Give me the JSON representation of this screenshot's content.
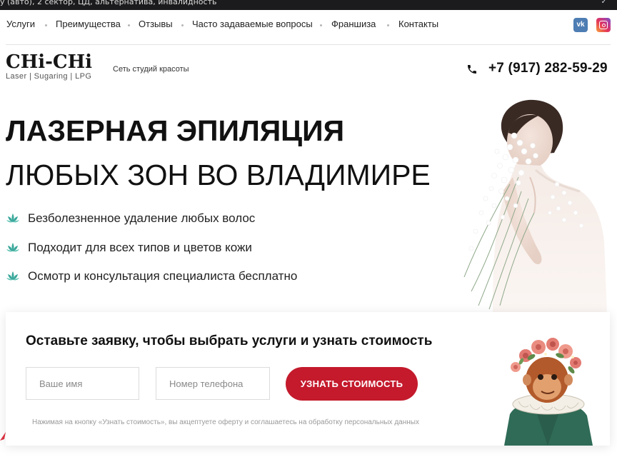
{
  "top_strip": {
    "text": "y (авто), 2 сектор, ЦД, альтернатива, инвалидность",
    "icon": "chevron-icon"
  },
  "nav": {
    "items": [
      {
        "label": "Услуги"
      },
      {
        "label": "Преимущества"
      },
      {
        "label": "Отзывы"
      },
      {
        "label": "Часто задаваемые вопросы"
      },
      {
        "label": "Франшиза"
      },
      {
        "label": "Контакты"
      }
    ],
    "social": [
      {
        "name": "vk-icon",
        "glyph": "vk",
        "color": "#4d7db3"
      },
      {
        "name": "instagram-icon",
        "color": "#e3335a"
      }
    ]
  },
  "header": {
    "logo_word": "CHi-CHi",
    "logo_tagline": "Laser | Sugaring | LPG",
    "tagline": "Сеть студий красоты",
    "phone": "+7 (917) 282-59-29"
  },
  "hero": {
    "title_bold": "ЛАЗЕРНАЯ ЭПИЛЯЦИЯ",
    "title_regular": "ЛЮБЫХ ЗОН ВО ВЛАДИМИРЕ",
    "features": [
      {
        "text": "Безболезненное удаление любых волос"
      },
      {
        "text": "Подходит для всех типов и цветов кожи"
      },
      {
        "text": "Осмотр и консультация специалиста бесплатно"
      }
    ]
  },
  "form": {
    "title": "Оставьте заявку, чтобы выбрать услуги и узнать стоимость",
    "name_placeholder": "Ваше имя",
    "phone_placeholder": "Номер телефона",
    "submit_label": "УЗНАТЬ СТОИМОСТЬ",
    "consent": "Нажимая на кнопку «Узнать стоимость», вы акцептуете оферту и соглашаетесь на обработку персональных данных"
  },
  "colors": {
    "accent": "#c41a2c",
    "lotus": "#3aa89b",
    "vk": "#4d7db3",
    "dark_strip": "#1b1b1d"
  }
}
